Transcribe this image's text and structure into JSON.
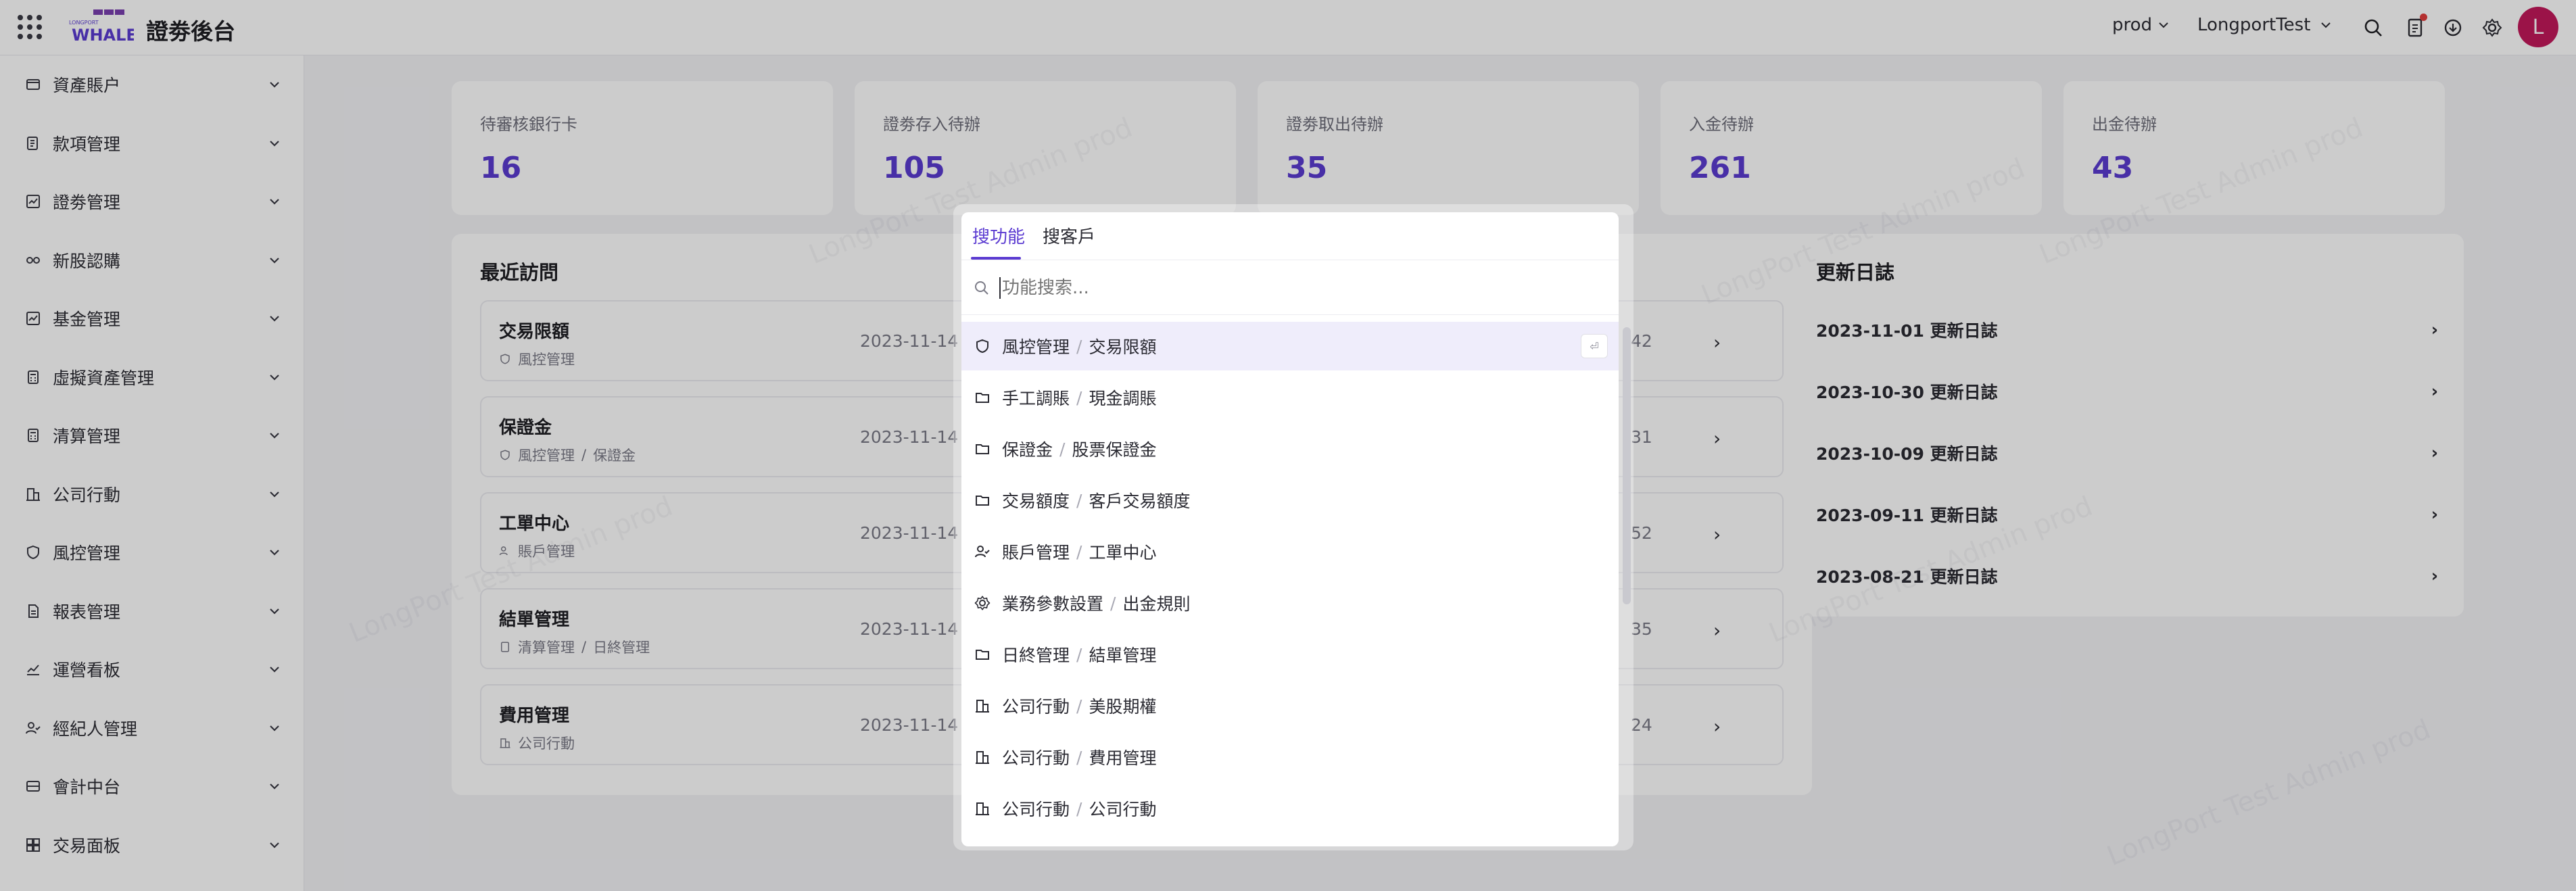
{
  "topbar": {
    "brand_small": "LONGPORT",
    "brand_big": "WHALE",
    "title": "證劵後台",
    "env": "prod",
    "org": "LongportTest",
    "avatar_letter": "L"
  },
  "sidebar": {
    "items": [
      {
        "label": "資產賬户",
        "icon": "wallet-icon"
      },
      {
        "label": "款項管理",
        "icon": "ledger-icon"
      },
      {
        "label": "證劵管理",
        "icon": "chart-box-icon"
      },
      {
        "label": "新股認購",
        "icon": "nodes-icon"
      },
      {
        "label": "基金管理",
        "icon": "chart-box-icon"
      },
      {
        "label": "虛擬資產管理",
        "icon": "calculator-icon"
      },
      {
        "label": "清算管理",
        "icon": "calculator-icon"
      },
      {
        "label": "公司行動",
        "icon": "building-icon"
      },
      {
        "label": "風控管理",
        "icon": "shield-icon"
      },
      {
        "label": "報表管理",
        "icon": "report-icon"
      },
      {
        "label": "運營看板",
        "icon": "trend-icon"
      },
      {
        "label": "經紀人管理",
        "icon": "users-icon"
      },
      {
        "label": "會計中台",
        "icon": "card-icon"
      },
      {
        "label": "交易面板",
        "icon": "grid-icon"
      }
    ]
  },
  "stats": [
    {
      "label": "待審核銀行卡",
      "value": "16"
    },
    {
      "label": "證劵存入待辦",
      "value": "105"
    },
    {
      "label": "證劵取出待辦",
      "value": "35"
    },
    {
      "label": "入金待辦",
      "value": "261"
    },
    {
      "label": "出金待辦",
      "value": "43"
    }
  ],
  "recent": {
    "title": "最近訪問",
    "items": [
      {
        "title": "交易限額",
        "path": [
          "風控管理"
        ],
        "date": "2023-11-14",
        "time": "42"
      },
      {
        "title": "保證金",
        "path": [
          "風控管理",
          "保證金"
        ],
        "date": "2023-11-14",
        "time": "31"
      },
      {
        "title": "工單中心",
        "path": [
          "賬戶管理"
        ],
        "date": "2023-11-14",
        "time": "52"
      },
      {
        "title": "結單管理",
        "path": [
          "清算管理",
          "日終管理"
        ],
        "date": "2023-11-14",
        "time": "35"
      },
      {
        "title": "費用管理",
        "path": [
          "公司行動"
        ],
        "date": "2023-11-14",
        "time": "24"
      }
    ]
  },
  "changelog": {
    "title": "更新日誌",
    "items": [
      "2023-11-01 更新日誌",
      "2023-10-30 更新日誌",
      "2023-10-09 更新日誌",
      "2023-09-11 更新日誌",
      "2023-08-21 更新日誌"
    ]
  },
  "watermark": "LongPort Test Admin prod",
  "search_modal": {
    "tabs": [
      "搜功能",
      "搜客戶"
    ],
    "active_tab": "搜功能",
    "placeholder": "功能搜索...",
    "enter_hint": "⏎",
    "results": [
      {
        "group": "風控管理",
        "name": "交易限額",
        "icon": "shield-icon"
      },
      {
        "group": "手工調賬",
        "name": "現金調賬",
        "icon": "folder-icon"
      },
      {
        "group": "保證金",
        "name": "股票保證金",
        "icon": "folder-icon"
      },
      {
        "group": "交易額度",
        "name": "客戶交易額度",
        "icon": "folder-icon"
      },
      {
        "group": "賬戶管理",
        "name": "工單中心",
        "icon": "users-icon"
      },
      {
        "group": "業務參數設置",
        "name": "出金規則",
        "icon": "gear-icon"
      },
      {
        "group": "日終管理",
        "name": "結單管理",
        "icon": "folder-icon"
      },
      {
        "group": "公司行動",
        "name": "美股期權",
        "icon": "building-icon"
      },
      {
        "group": "公司行動",
        "name": "費用管理",
        "icon": "building-icon"
      },
      {
        "group": "公司行動",
        "name": "公司行動",
        "icon": "building-icon"
      }
    ]
  },
  "colors": {
    "accent": "#5b3bd1",
    "avatar": "#c2185b"
  }
}
